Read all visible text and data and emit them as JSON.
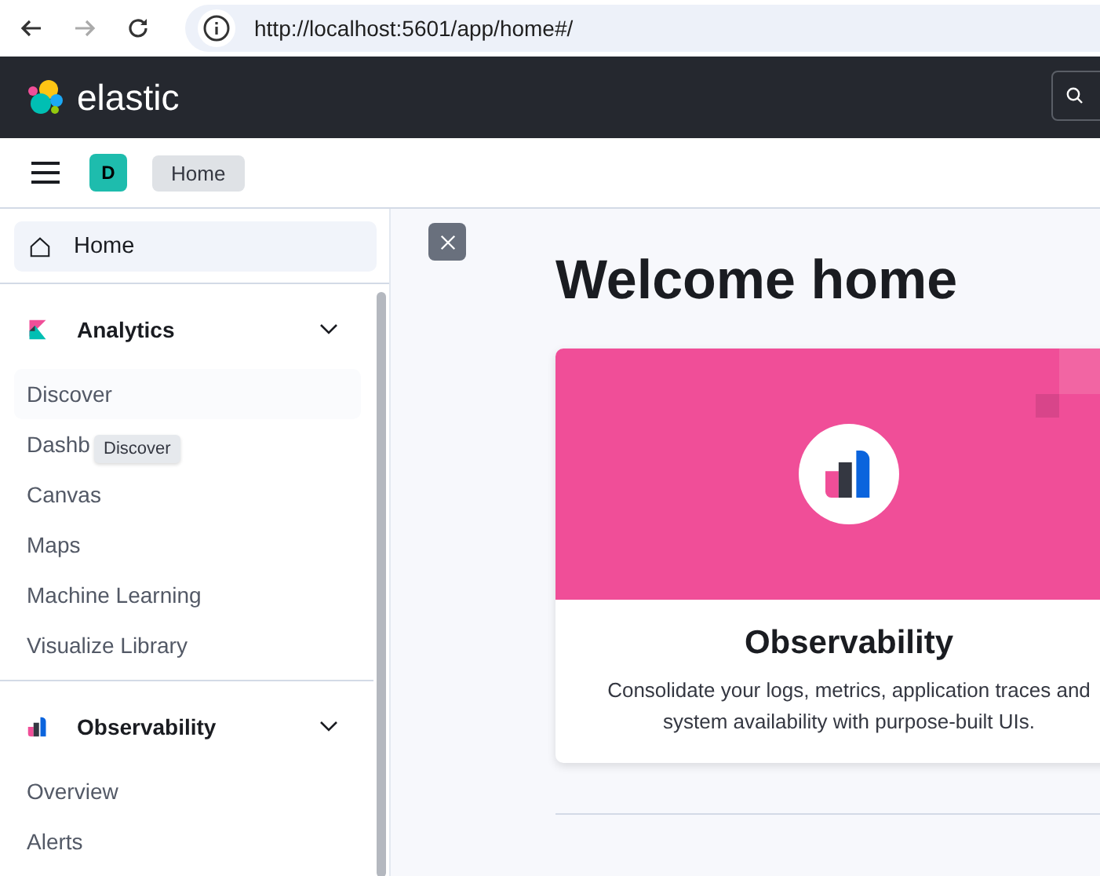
{
  "browser": {
    "url": "http://localhost:5601/app/home#/",
    "forward_disabled": true
  },
  "header": {
    "brand": "elastic"
  },
  "breadcrumbs": {
    "avatar": "D",
    "items": [
      "Home"
    ]
  },
  "sidebar": {
    "home": {
      "label": "Home",
      "selected": true
    },
    "groups": [
      {
        "title": "Analytics",
        "kind": "analytics",
        "expanded": true,
        "items": [
          {
            "label": "Discover",
            "hovered": true
          },
          {
            "label": "Dashb",
            "hovered": false
          },
          {
            "label": "Canvas",
            "hovered": false
          },
          {
            "label": "Maps",
            "hovered": false
          },
          {
            "label": "Machine Learning",
            "hovered": false
          },
          {
            "label": "Visualize Library",
            "hovered": false
          }
        ]
      },
      {
        "title": "Observability",
        "kind": "observability",
        "expanded": true,
        "items": [
          {
            "label": "Overview",
            "hovered": false
          },
          {
            "label": "Alerts",
            "hovered": false
          }
        ]
      }
    ],
    "tooltip": "Discover"
  },
  "main": {
    "title": "Welcome home",
    "card": {
      "title": "Observability",
      "description": "Consolidate your logs, metrics, application traces and system availability with purpose-built UIs.",
      "color": "#f04e98"
    }
  }
}
